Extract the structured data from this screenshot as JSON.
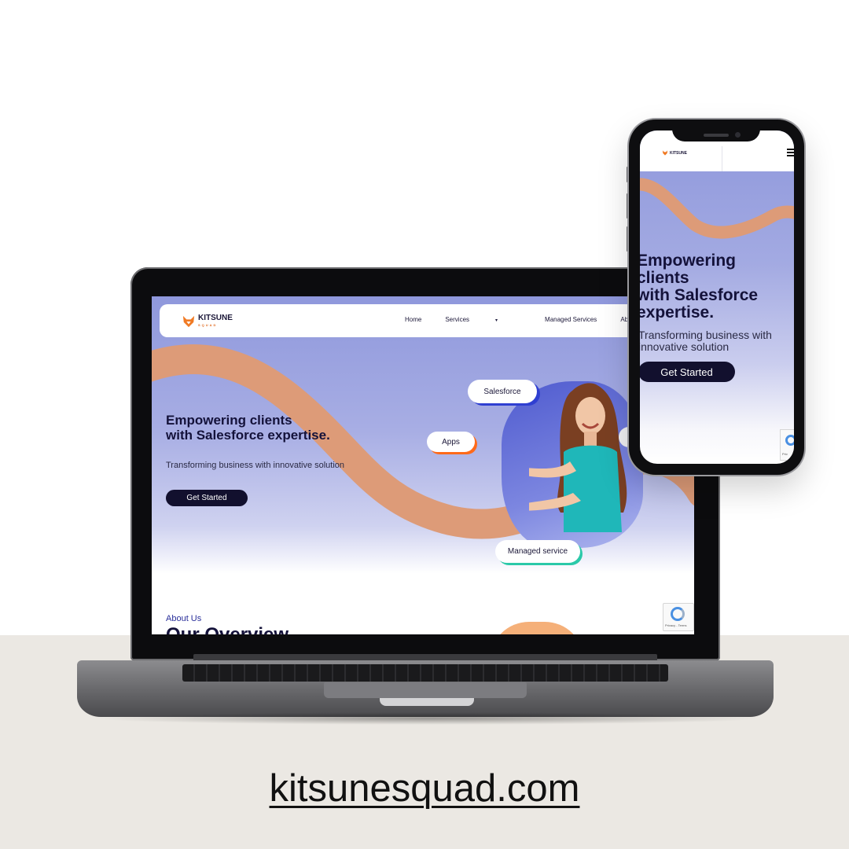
{
  "laptop_site": {
    "logo": {
      "name": "KITSUNE",
      "sub": "SQUAD"
    },
    "nav": [
      {
        "label": "Home"
      },
      {
        "label": "Services",
        "has_dropdown": true
      },
      {
        "label": "Managed Services"
      },
      {
        "label": "About Us"
      }
    ],
    "hero": {
      "title": "Empowering clients\nwith Salesforce expertise.",
      "subtitle": "Transforming business with innovative solution",
      "cta": "Get Started"
    },
    "pills": {
      "salesforce": "Salesforce",
      "apps": "Apps",
      "managed": "Managed service",
      "edge": "r"
    },
    "about": {
      "label": "About Us",
      "title": "Our Overview"
    },
    "recaptcha_text": "Privacy - Terms"
  },
  "phone_site": {
    "logo": {
      "name": "KITSUNE"
    },
    "hero": {
      "title": "Empowering\nclients\nwith Salesforce\nexpertise.",
      "subtitle": "Transforming business with\ninnovative solution",
      "cta": "Get Started"
    },
    "recaptcha_text": "Priv"
  },
  "caption": {
    "url": "kitsunesquad.com"
  },
  "colors": {
    "hero_gradient_top": "#8f98dc",
    "wave": "#dd9b78",
    "navy": "#12102e",
    "salesforce_accent": "#2f3fd1",
    "apps_accent": "#ff6a1a",
    "managed_accent": "#2bc9a9",
    "desk": "#ebe8e3"
  }
}
